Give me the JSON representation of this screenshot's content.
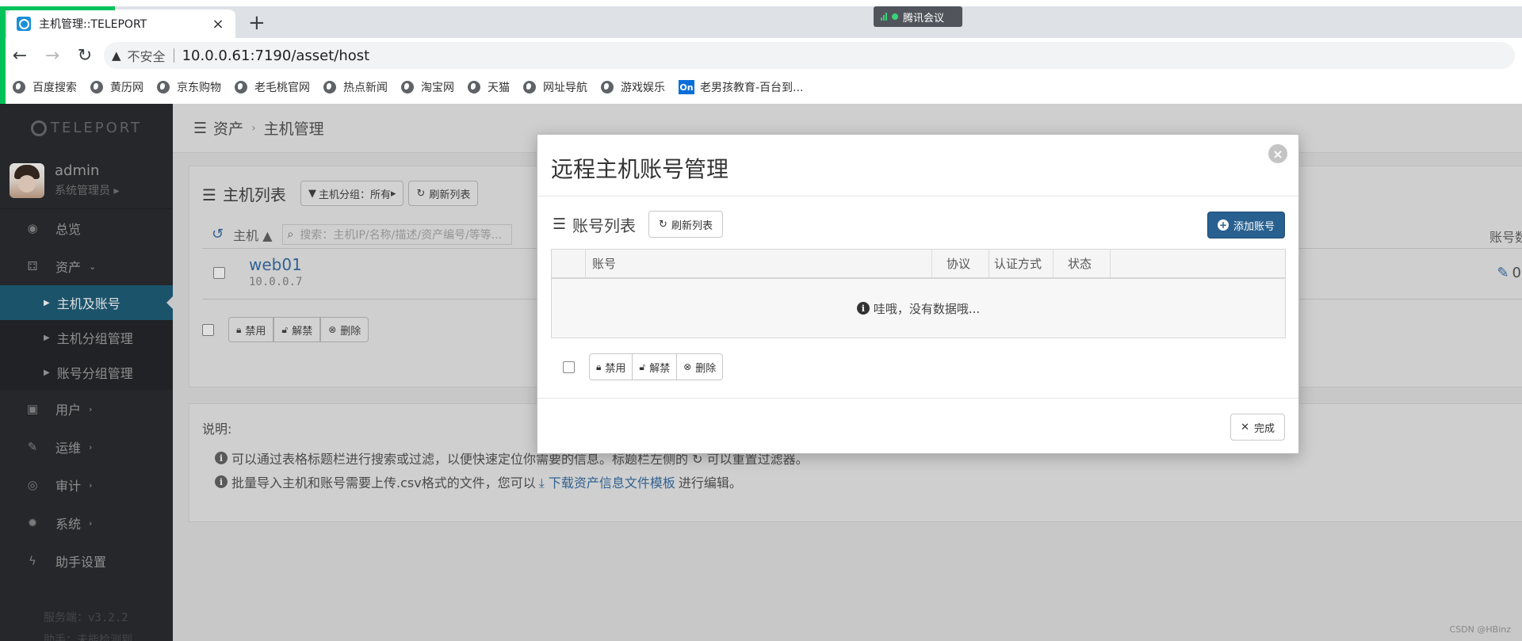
{
  "browser": {
    "tab_title": "主机管理::TELEPORT",
    "tab_close": "×",
    "new_tab": "+",
    "meeting_label": "腾讯会议",
    "insecure_label": "不安全",
    "url": "10.0.0.61:7190/asset/host",
    "bookmarks": [
      {
        "label": "百度搜索",
        "icon": "globe-icon"
      },
      {
        "label": "黄历网",
        "icon": "globe-icon"
      },
      {
        "label": "京东购物",
        "icon": "globe-icon"
      },
      {
        "label": "老毛桃官网",
        "icon": "globe-icon"
      },
      {
        "label": "热点新闻",
        "icon": "globe-icon"
      },
      {
        "label": "淘宝网",
        "icon": "globe-icon"
      },
      {
        "label": "天猫",
        "icon": "globe-icon"
      },
      {
        "label": "网址导航",
        "icon": "globe-icon"
      },
      {
        "label": "游戏娱乐",
        "icon": "globe-icon"
      },
      {
        "label": "老男孩教育-百台到...",
        "icon": "on-icon",
        "icon_text": "On"
      }
    ]
  },
  "sidebar": {
    "logo": "TELEPORT",
    "username": "admin",
    "role": "系统管理员",
    "menu": {
      "overview": "总览",
      "assets": "资产",
      "hosts_accounts": "主机及账号",
      "host_groups": "主机分组管理",
      "account_groups": "账号分组管理",
      "users": "用户",
      "ops": "运维",
      "audit": "审计",
      "system": "系统",
      "assistant": "助手设置"
    },
    "version_line1": "服务端：v3.2.2",
    "version_line2": "助手：未能检测到"
  },
  "page": {
    "crumb_root": "资产",
    "crumb_current": "主机管理",
    "host_list_title": "主机列表",
    "filter_btn": "主机分组：所有",
    "refresh_btn": "刷新列表",
    "col_host": "主机",
    "search_placeholder": "搜索：主机IP/名称/描述/资产编号/等等...",
    "col_accounts": "账号数",
    "rows": [
      {
        "name": "web01",
        "ip": "10.0.0.7",
        "accounts": "0"
      }
    ],
    "bulk": {
      "disable": "禁用",
      "enable": "解禁",
      "delete": "删除"
    },
    "notes_title": "说明:",
    "note1": "可以通过表格标题栏进行搜索或过滤，以便快速定位你需要的信息。标题栏左侧的 ↻ 可以重置过滤器。",
    "note2_pre": "批量导入主机和账号需要上传.csv格式的文件，您可以",
    "note2_link": "下载资产信息文件模板",
    "note2_post": "进行编辑。"
  },
  "modal": {
    "title": "远程主机账号管理",
    "close": "×",
    "list_title": "账号列表",
    "refresh_btn": "刷新列表",
    "add_btn": "添加账号",
    "columns": [
      "账号",
      "协议",
      "认证方式",
      "状态"
    ],
    "empty_text": "哇哦，没有数据哦...",
    "bulk": {
      "disable": "禁用",
      "enable": "解禁",
      "delete": "删除"
    },
    "done_btn": "完成"
  },
  "watermark": "CSDN @HBinz"
}
